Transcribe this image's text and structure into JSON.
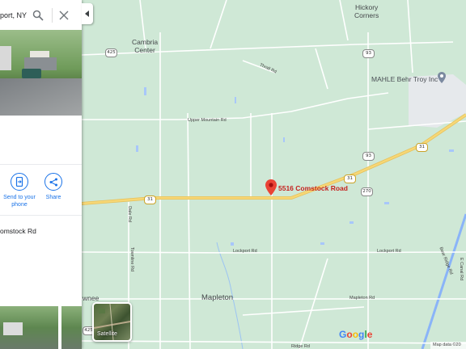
{
  "search": {
    "value": "port, NY"
  },
  "place": {
    "address_line": "omstock Rd",
    "actions": [
      {
        "label_line1": "Send to your",
        "label_line2": "phone",
        "icon": "phone-send-icon"
      },
      {
        "label_line1": "Share",
        "label_line2": "",
        "icon": "share-icon"
      }
    ]
  },
  "map": {
    "marker_label": "5516 Comstock Road",
    "poi_label": "MAHLE Behr Troy Inc",
    "towns": {
      "hickory": "Hickory\nCorners",
      "cambria": "Cambria\nCenter",
      "mapleton": "Mapleton",
      "pawnee": "wnee"
    },
    "road_names": {
      "upper_mountain": "Upper Mountain Rd",
      "lockport": "Lockport Rd",
      "lockport2": "Lockport Rd",
      "lower_mapleton": "Mapleton Rd",
      "thrall": "Thrall Rd",
      "dale": "Dale Rd",
      "townline": "Townline Rd",
      "east_canal": "E Canal Rd",
      "bear_ridge": "Bear Ridge Rd",
      "ridge": "Ridge Rd"
    },
    "shields": {
      "r31_a": "31",
      "r31_b": "31",
      "r31_c": "31",
      "r425_a": "425",
      "r425_b": "425",
      "r93_a": "93",
      "r93_b": "93",
      "r270": "270"
    },
    "satellite_label": "Satellite",
    "google_logo": [
      "G",
      "o",
      "o",
      "g",
      "l",
      "e"
    ],
    "attribution": "Map data ©20"
  },
  "colors": {
    "map_bg": "#cfe8d6",
    "highway": "#f6d776",
    "road": "#ffffff",
    "water": "#8ab4f8",
    "marker": "#ea4335",
    "accent": "#1a73e8"
  }
}
